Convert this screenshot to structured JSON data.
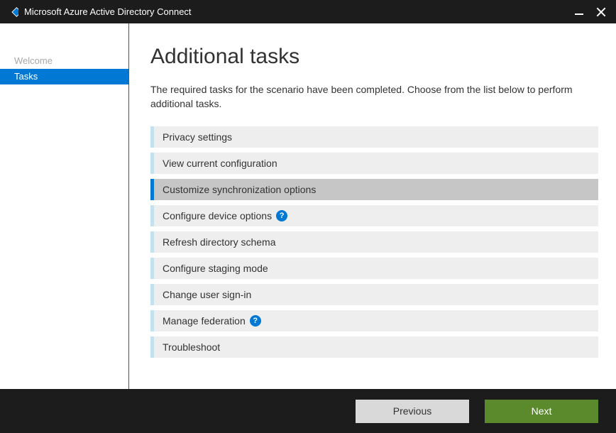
{
  "titlebar": {
    "app_title": "Microsoft Azure Active Directory Connect"
  },
  "sidebar": {
    "items": [
      {
        "label": "Welcome",
        "state": "inactive"
      },
      {
        "label": "Tasks",
        "state": "active"
      }
    ]
  },
  "content": {
    "heading": "Additional tasks",
    "intro": "The required tasks for the scenario have been completed. Choose from the list below to perform additional tasks.",
    "tasks": [
      {
        "label": "Privacy settings",
        "selected": false,
        "help": false
      },
      {
        "label": "View current configuration",
        "selected": false,
        "help": false
      },
      {
        "label": "Customize synchronization options",
        "selected": true,
        "help": false
      },
      {
        "label": "Configure device options",
        "selected": false,
        "help": true
      },
      {
        "label": "Refresh directory schema",
        "selected": false,
        "help": false
      },
      {
        "label": "Configure staging mode",
        "selected": false,
        "help": false
      },
      {
        "label": "Change user sign-in",
        "selected": false,
        "help": false
      },
      {
        "label": "Manage federation",
        "selected": false,
        "help": true
      },
      {
        "label": "Troubleshoot",
        "selected": false,
        "help": false
      }
    ]
  },
  "footer": {
    "previous_label": "Previous",
    "next_label": "Next"
  }
}
